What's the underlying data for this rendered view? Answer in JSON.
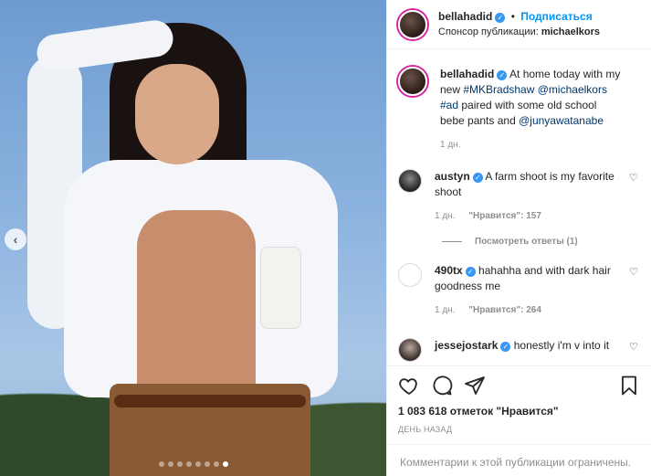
{
  "post": {
    "author": "bellahadid",
    "follow_label": "Подписаться",
    "separator": "•",
    "sponsor_prefix": "Спонсор публикации:",
    "sponsor_name": "michaelkors",
    "carousel_dots": 8,
    "carousel_active": 7
  },
  "caption": {
    "author": "bellahadid",
    "text_1": "At home today with my new",
    "tag_1": "#MKBradshaw",
    "mention_1": "@michaelkors",
    "tag_2": "#ad",
    "text_2": "paired with some old school bebe pants and",
    "mention_2": "@junyawatanabe",
    "age": "1 дн."
  },
  "comments": [
    {
      "author": "austyn",
      "text": "A farm shoot is my favorite shoot",
      "age": "1 дн.",
      "likes": "\"Нравится\": 157"
    },
    {
      "author": "490tx",
      "text": "hahahha and with dark hair goodness me",
      "age": "1 дн.",
      "likes": "\"Нравится\": 264"
    },
    {
      "author": "jessejostark",
      "text": "honestly i'm v into it"
    }
  ],
  "replies_label": "Посмотреть ответы (1)",
  "likes_text": "1 083 618 отметок \"Нравится\"",
  "date_label": "ДЕНЬ НАЗАД",
  "restricted_text": "Комментарии к этой публикации ограничены.",
  "icons": {
    "verified": "verified-badge-icon",
    "heart": "heart-icon",
    "comment": "comment-icon",
    "share": "paper-plane-icon",
    "save": "bookmark-icon",
    "prev": "chevron-left-icon"
  },
  "colors": {
    "accent": "#0095f6",
    "verified": "#3897f0",
    "muted": "#8e8e8e",
    "link": "#00376b"
  }
}
